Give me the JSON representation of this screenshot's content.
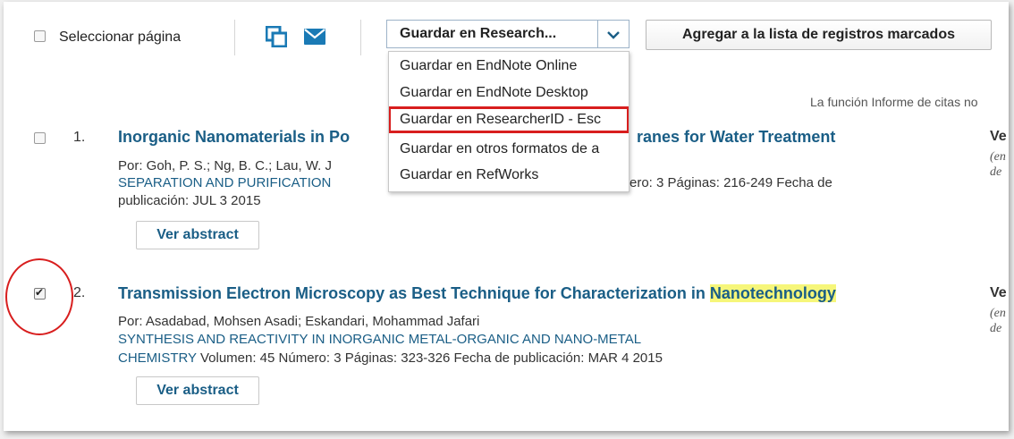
{
  "toolbar": {
    "select_page_label": "Seleccionar página",
    "print_icon": "print-icon",
    "mail_icon": "mail-icon",
    "save_select_value": "Guardar en Research...",
    "add_marked_label": "Agregar a la lista de registros marcados"
  },
  "dropdown": {
    "items": [
      "Guardar en EndNote Online",
      "Guardar en EndNote Desktop",
      "Guardar en ResearcherID - Esc",
      "Guardar en otros formatos de a",
      "Guardar en RefWorks"
    ],
    "highlighted_index": 2
  },
  "citations_note": "La función Informe de citas no",
  "records": [
    {
      "number": "1.",
      "checked": false,
      "title_visible": "Inorganic Nanomaterials in Po",
      "title_tail": "ranes for Water Treatment",
      "authors": "Por: Goh, P. S.; Ng, B. C.; Lau, W. J",
      "source": "SEPARATION AND PURIFICATION",
      "details_tail": "ero: 3   Páginas: 216-249   Fecha de",
      "pub_line": "publicación: JUL 3 2015",
      "abstract_label": "Ver abstract",
      "right_label": "Ve",
      "right_italic": [
        "(en",
        "de"
      ]
    },
    {
      "number": "2.",
      "checked": true,
      "title_pre": "Transmission Electron Microscopy as Best Technique for Characterization in ",
      "title_highlight": "Nanotechnology",
      "authors": "Por: Asadabad, Mohsen Asadi; Eskandari, Mohammad Jafari",
      "source_line1": "SYNTHESIS AND REACTIVITY IN INORGANIC METAL-ORGANIC AND NANO-METAL",
      "source_line2": "CHEMISTRY",
      "details": "  Volumen: 45   Número: 3   Páginas: 323-326   Fecha de publicación: MAR 4 2015",
      "abstract_label": "Ver abstract",
      "right_label": "Ve",
      "right_italic": [
        "(en",
        "de"
      ]
    }
  ],
  "colors": {
    "link_blue": "#1a5e86",
    "icon_blue": "#1a7ab5",
    "annotation_red": "#d81e1e",
    "highlight_yellow": "#f6f67a"
  }
}
